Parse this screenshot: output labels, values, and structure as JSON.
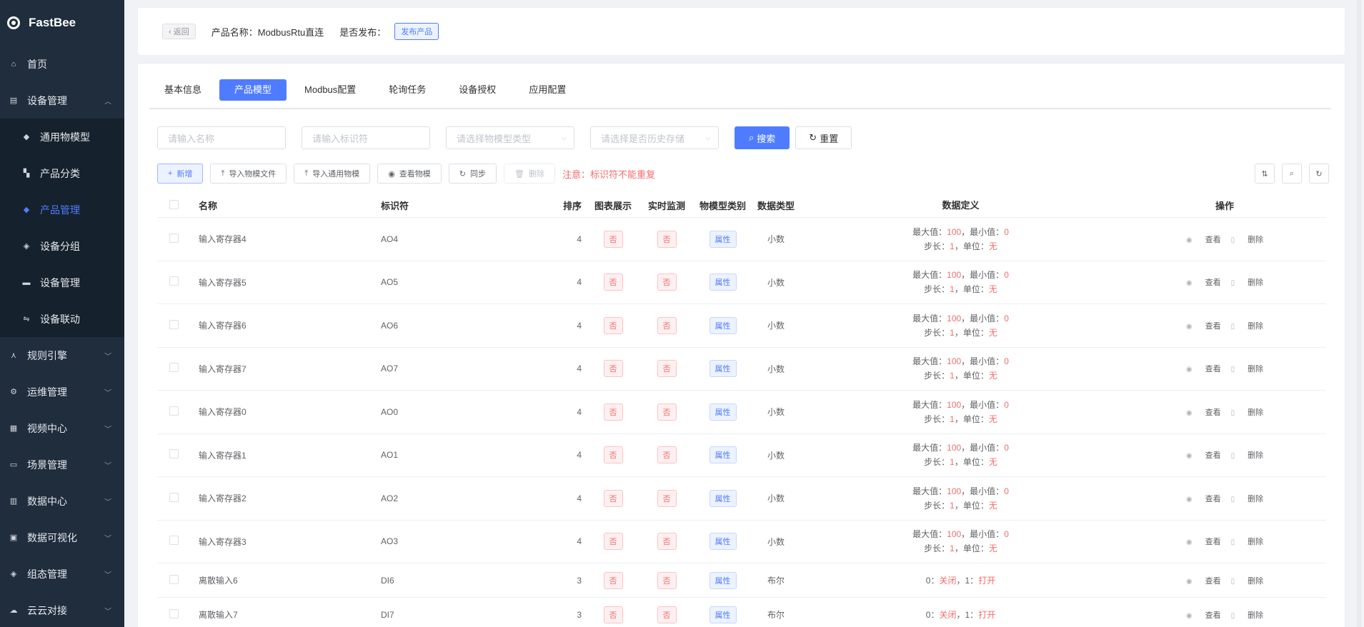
{
  "app": {
    "name": "FastBee"
  },
  "sidebar": {
    "items": [
      {
        "label": "首页",
        "icon": "home-icon",
        "glyph": "⌂"
      },
      {
        "label": "设备管理",
        "icon": "device-icon",
        "glyph": "▤",
        "expanded": true
      },
      {
        "label": "规则引擎",
        "icon": "rule-icon",
        "glyph": "⋏"
      },
      {
        "label": "运维管理",
        "icon": "ops-icon",
        "glyph": "⚙"
      },
      {
        "label": "视频中心",
        "icon": "video-icon",
        "glyph": "▦"
      },
      {
        "label": "场景管理",
        "icon": "scene-icon",
        "glyph": "▭"
      },
      {
        "label": "数据中心",
        "icon": "data-icon",
        "glyph": "▥"
      },
      {
        "label": "数据可视化",
        "icon": "chart-icon",
        "glyph": "▣"
      },
      {
        "label": "组态管理",
        "icon": "config-icon",
        "glyph": "◈"
      },
      {
        "label": "云云对接",
        "icon": "cloud-icon",
        "glyph": "☁"
      }
    ],
    "subitems": [
      {
        "label": "通用物模型",
        "glyph": "◆"
      },
      {
        "label": "产品分类",
        "glyph": "▚"
      },
      {
        "label": "产品管理",
        "glyph": "◆",
        "active": true
      },
      {
        "label": "设备分组",
        "glyph": "◈"
      },
      {
        "label": "设备管理",
        "glyph": "▬"
      },
      {
        "label": "设备联动",
        "glyph": "⇋"
      }
    ]
  },
  "header": {
    "back_label": "返回",
    "product_label": "产品名称：",
    "product_name": "ModbusRtu直连",
    "publish_label": "是否发布：",
    "publish_button": "发布产品"
  },
  "tabs": [
    "基本信息",
    "产品模型",
    "Modbus配置",
    "轮询任务",
    "设备授权",
    "应用配置"
  ],
  "filters": {
    "name_placeholder": "请输入名称",
    "id_placeholder": "请输入标识符",
    "type_placeholder": "请选择物模型类型",
    "history_placeholder": "请选择是否历史存储",
    "search_label": "搜索",
    "reset_label": "重置"
  },
  "toolbar": {
    "add": "新增",
    "import_file": "导入物模文件",
    "import_generic": "导入通用物模",
    "view_model": "查看物模",
    "sync": "同步",
    "delete": "删除",
    "notice": "注意：标识符不能重复"
  },
  "table": {
    "headers": [
      "名称",
      "标识符",
      "排序",
      "图表展示",
      "实时监测",
      "物模型类别",
      "数据类型",
      "数据定义",
      "操作"
    ],
    "def_labels": {
      "max": "最大值：",
      "min": "，最小值：",
      "step": "步长：",
      "unit": "，单位："
    },
    "rows": [
      {
        "name": "输入寄存器4",
        "id": "AO4",
        "order": "4",
        "chart": "否",
        "live": "否",
        "category": "属性",
        "dtype": "小数",
        "max": "100",
        "min": "0",
        "step": "1",
        "unit": "无"
      },
      {
        "name": "输入寄存器5",
        "id": "AO5",
        "order": "4",
        "chart": "否",
        "live": "否",
        "category": "属性",
        "dtype": "小数",
        "max": "100",
        "min": "0",
        "step": "1",
        "unit": "无"
      },
      {
        "name": "输入寄存器6",
        "id": "AO6",
        "order": "4",
        "chart": "否",
        "live": "否",
        "category": "属性",
        "dtype": "小数",
        "max": "100",
        "min": "0",
        "step": "1",
        "unit": "无"
      },
      {
        "name": "输入寄存器7",
        "id": "AO7",
        "order": "4",
        "chart": "否",
        "live": "否",
        "category": "属性",
        "dtype": "小数",
        "max": "100",
        "min": "0",
        "step": "1",
        "unit": "无"
      },
      {
        "name": "输入寄存器0",
        "id": "AO0",
        "order": "4",
        "chart": "否",
        "live": "否",
        "category": "属性",
        "dtype": "小数",
        "max": "100",
        "min": "0",
        "step": "1",
        "unit": "无"
      },
      {
        "name": "输入寄存器1",
        "id": "AO1",
        "order": "4",
        "chart": "否",
        "live": "否",
        "category": "属性",
        "dtype": "小数",
        "max": "100",
        "min": "0",
        "step": "1",
        "unit": "无"
      },
      {
        "name": "输入寄存器2",
        "id": "AO2",
        "order": "4",
        "chart": "否",
        "live": "否",
        "category": "属性",
        "dtype": "小数",
        "max": "100",
        "min": "0",
        "step": "1",
        "unit": "无"
      },
      {
        "name": "输入寄存器3",
        "id": "AO3",
        "order": "4",
        "chart": "否",
        "live": "否",
        "category": "属性",
        "dtype": "小数",
        "max": "100",
        "min": "0",
        "step": "1",
        "unit": "无"
      }
    ],
    "bool_rows": [
      {
        "name": "离散输入6",
        "id": "DI6",
        "order": "3",
        "chart": "否",
        "live": "否",
        "category": "属性",
        "dtype": "布尔",
        "k0": "0：",
        "v0": "关闭",
        "k1": "，1：",
        "v1": "打开"
      },
      {
        "name": "离散输入7",
        "id": "DI7",
        "order": "3",
        "chart": "否",
        "live": "否",
        "category": "属性",
        "dtype": "布尔",
        "k0": "0：",
        "v0": "关闭",
        "k1": "，1：",
        "v1": "打开"
      }
    ],
    "op_view": "查看",
    "op_delete": "删除"
  }
}
